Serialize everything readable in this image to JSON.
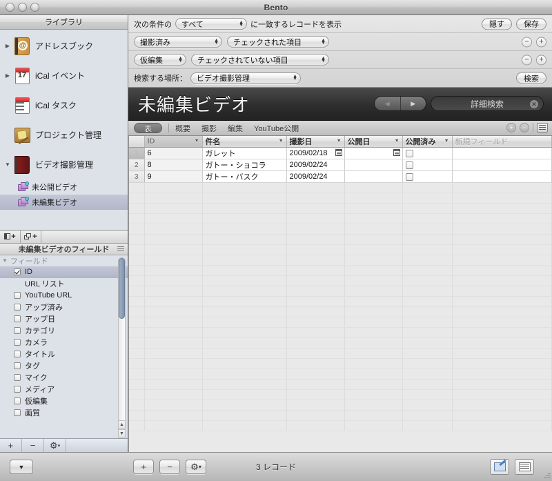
{
  "window": {
    "title": "Bento"
  },
  "sidebar": {
    "header": "ライブラリ",
    "items": [
      {
        "label": "アドレスブック",
        "icon": "address-book-icon",
        "disclosure": "▶",
        "selected": false
      },
      {
        "label": "iCal イベント",
        "icon": "calendar-event-icon",
        "disclosure": "▶",
        "selected": false
      },
      {
        "label": "iCal タスク",
        "icon": "calendar-task-icon",
        "disclosure": "",
        "selected": false
      },
      {
        "label": "プロジェクト管理",
        "icon": "project-icon",
        "disclosure": "",
        "selected": false
      },
      {
        "label": "ビデオ撮影管理",
        "icon": "video-library-icon",
        "disclosure": "▼",
        "selected": false
      }
    ],
    "sub_items": [
      {
        "label": "未公開ビデオ",
        "icon": "smart-collection-icon",
        "selected": false
      },
      {
        "label": "未編集ビデオ",
        "icon": "smart-collection-icon",
        "selected": true
      }
    ],
    "footer_buttons": [
      "+",
      "−",
      "⚙"
    ]
  },
  "fields_panel": {
    "toolbar": [
      "new-field-icon",
      "new-field-set-icon"
    ],
    "header": "未編集ビデオのフィールド",
    "group_label": "フィールド",
    "fields": [
      {
        "label": "ID",
        "checked": true,
        "has_checkbox": true,
        "selected": true
      },
      {
        "label": "URL リスト",
        "checked": false,
        "has_checkbox": false,
        "selected": false
      },
      {
        "label": "YouTube URL",
        "checked": false,
        "has_checkbox": true,
        "selected": false
      },
      {
        "label": "アップ済み",
        "checked": false,
        "has_checkbox": true,
        "selected": false
      },
      {
        "label": "アップ日",
        "checked": false,
        "has_checkbox": true,
        "selected": false
      },
      {
        "label": "カテゴリ",
        "checked": false,
        "has_checkbox": true,
        "selected": false
      },
      {
        "label": "カメラ",
        "checked": false,
        "has_checkbox": true,
        "selected": false
      },
      {
        "label": "タイトル",
        "checked": false,
        "has_checkbox": true,
        "selected": false
      },
      {
        "label": "タグ",
        "checked": false,
        "has_checkbox": true,
        "selected": false
      },
      {
        "label": "マイク",
        "checked": false,
        "has_checkbox": true,
        "selected": false
      },
      {
        "label": "メディア",
        "checked": false,
        "has_checkbox": true,
        "selected": false
      },
      {
        "label": "仮編集",
        "checked": false,
        "has_checkbox": true,
        "selected": false
      },
      {
        "label": "画質",
        "checked": false,
        "has_checkbox": true,
        "selected": false
      }
    ],
    "footer_buttons": [
      "+",
      "−",
      "⚙"
    ]
  },
  "find_bar": {
    "row1": {
      "prefix": "次の条件の",
      "match_value": "すべて",
      "suffix": "に一致するレコードを表示",
      "hide_button": "隠す",
      "save_button": "保存"
    },
    "criteria": [
      {
        "field": "撮影済み",
        "condition": "チェックされた項目",
        "minus": "−",
        "plus": "+"
      },
      {
        "field": "仮編集",
        "condition": "チェックされていない項目",
        "minus": "−",
        "plus": "+"
      }
    ],
    "row_search": {
      "label": "検索する場所：",
      "value": "ビデオ撮影管理",
      "button": "検索"
    }
  },
  "record_header": {
    "title": "未編集ビデオ",
    "nav_prev": "◀",
    "nav_next": "▶",
    "search_label": "詳細検索",
    "search_clear": "✕"
  },
  "tabs": {
    "selected": "表",
    "items": [
      "概要",
      "撮影",
      "編集",
      "YouTube公開"
    ],
    "right_controls": [
      "add-record-icon",
      "remove-record-icon",
      "view-toggle-icon"
    ]
  },
  "table": {
    "columns": [
      "ID",
      "件名",
      "撮影日",
      "公開日",
      "公開済み",
      "新規フィールド"
    ],
    "rows": [
      {
        "num": "1",
        "id": "6",
        "subject": "ガレット",
        "shot_date": "2009/02/18",
        "pub_date": "",
        "published": false,
        "selected": true
      },
      {
        "num": "2",
        "id": "8",
        "subject": "ガトー・ショコラ",
        "shot_date": "2009/02/24",
        "pub_date": "",
        "published": false,
        "selected": false
      },
      {
        "num": "3",
        "id": "9",
        "subject": "ガトー・バスク",
        "shot_date": "2009/02/24",
        "pub_date": "",
        "published": false,
        "selected": false
      }
    ]
  },
  "bottom_bar": {
    "collapse_button": "▼",
    "add_button": "+",
    "remove_button": "−",
    "action_button": "⚙",
    "record_count": "3 レコード",
    "form_view_icon": "form-view-icon",
    "table_view_icon": "table-view-icon"
  },
  "colors": {
    "selection": "#b7bccd",
    "header_dark": "#2e2e2e",
    "window_chrome": "#d5d5d5"
  }
}
